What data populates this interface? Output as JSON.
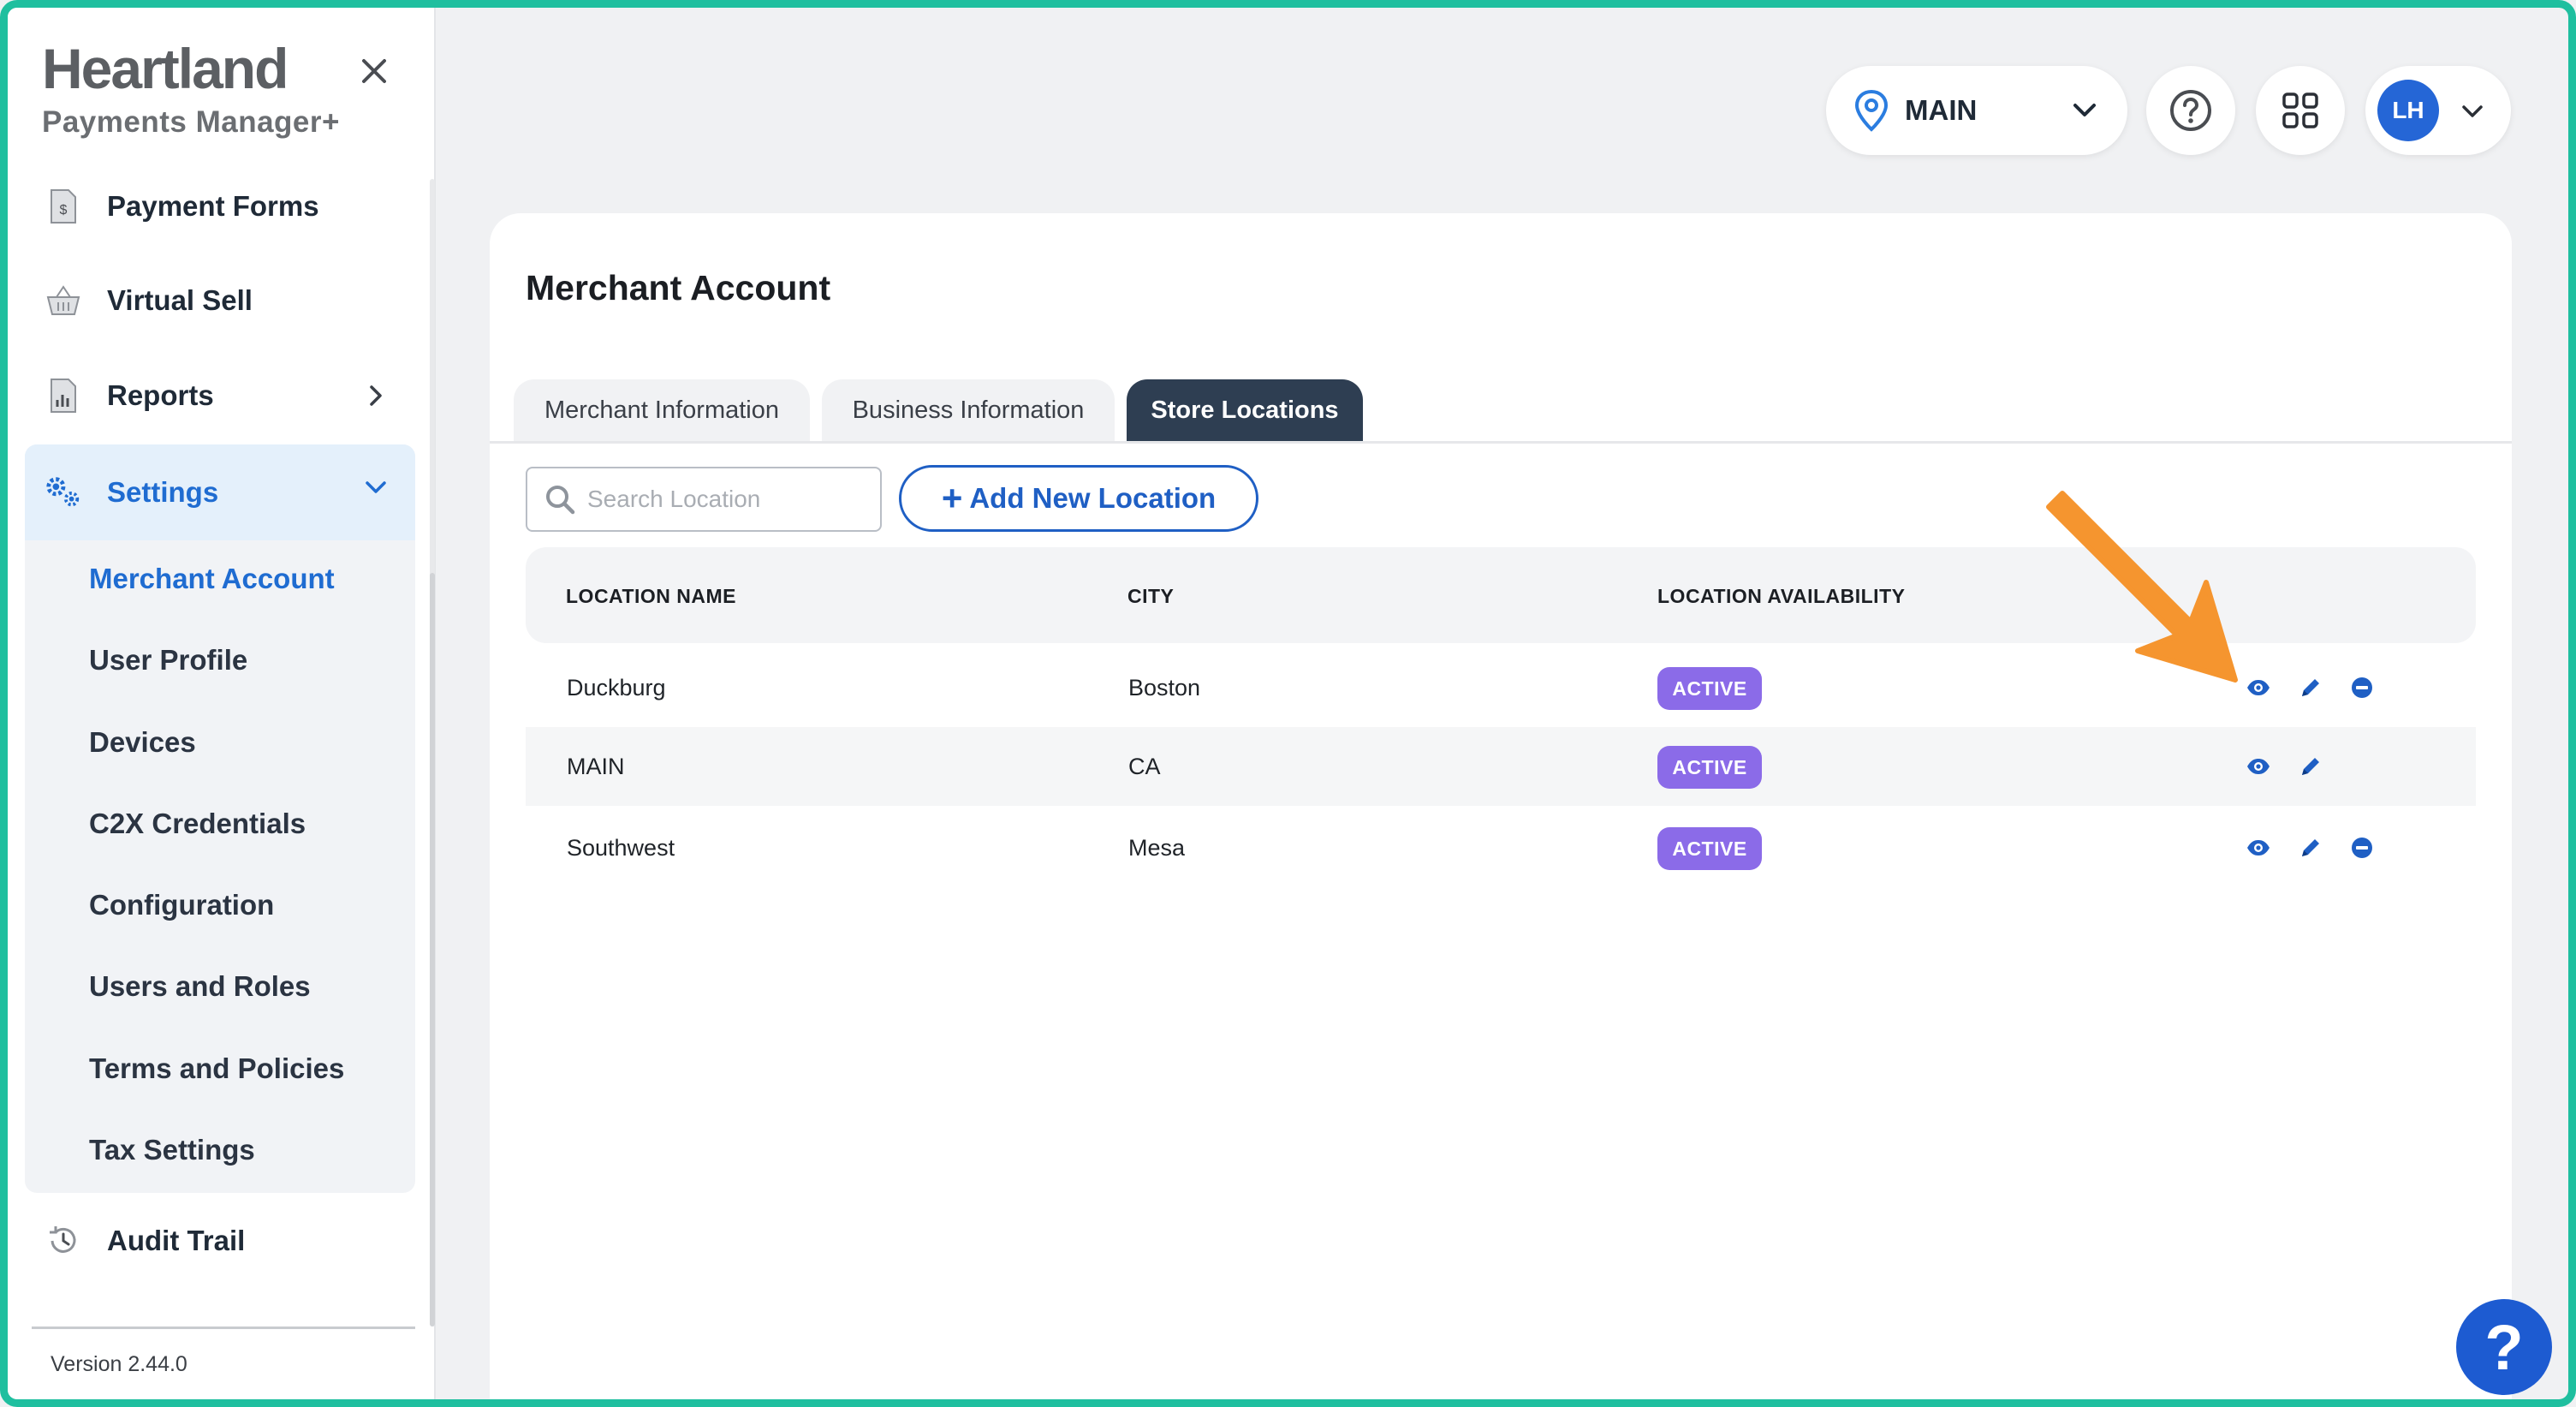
{
  "sidebar": {
    "logo_main": "Heartland",
    "logo_sub": "Payments Manager+",
    "items": [
      {
        "label": "Payment Forms",
        "icon": "document-dollar-icon"
      },
      {
        "label": "Virtual Sell",
        "icon": "basket-icon"
      },
      {
        "label": "Reports",
        "icon": "report-chart-icon"
      },
      {
        "label": "Settings",
        "icon": "gears-icon"
      },
      {
        "label": "Audit Trail",
        "icon": "history-icon"
      }
    ],
    "settings_sub": [
      "Merchant Account",
      "User Profile",
      "Devices",
      "C2X Credentials",
      "Configuration",
      "Users and Roles",
      "Terms and Policies",
      "Tax Settings"
    ],
    "version": "Version 2.44.0"
  },
  "header": {
    "location": "MAIN",
    "user_initials": "LH"
  },
  "main": {
    "title": "Merchant Account",
    "tabs": [
      "Merchant Information",
      "Business Information",
      "Store Locations"
    ],
    "active_tab": "Store Locations",
    "search_placeholder": "Search Location",
    "add_button": "Add New Location",
    "table": {
      "headers": [
        "LOCATION NAME",
        "CITY",
        "LOCATION AVAILABILITY"
      ],
      "rows": [
        {
          "name": "Duckburg",
          "city": "Boston",
          "status": "ACTIVE"
        },
        {
          "name": "MAIN",
          "city": "CA",
          "status": "ACTIVE"
        },
        {
          "name": "Southwest",
          "city": "Mesa",
          "status": "ACTIVE"
        }
      ]
    }
  },
  "help_fab": "?",
  "colors": {
    "frame": "#1fbf9f",
    "accent_blue": "#1f5fc4",
    "active_tab": "#2e3e52",
    "badge": "#8b6be8",
    "arrow": "#f5952f"
  }
}
